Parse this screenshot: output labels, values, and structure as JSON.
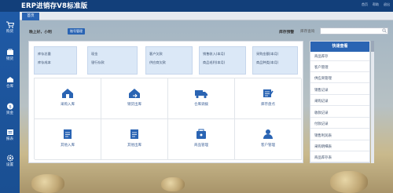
{
  "app": {
    "title": "ERP进销存V8标准版",
    "top_links": [
      "首页",
      "帮助",
      "退出"
    ]
  },
  "sidebar": {
    "items": [
      {
        "label": "购货",
        "icon": "cart-icon"
      },
      {
        "label": "销货",
        "icon": "sales-icon"
      },
      {
        "label": "仓库",
        "icon": "warehouse-icon"
      },
      {
        "label": "资金",
        "icon": "money-icon"
      },
      {
        "label": "报表",
        "icon": "report-icon"
      },
      {
        "label": "设置",
        "icon": "gear-icon"
      }
    ]
  },
  "tabs": [
    {
      "label": "首页"
    }
  ],
  "greeting": {
    "text": "晚上好，小明",
    "badge": "账号管理"
  },
  "stock": {
    "label": "库存预警",
    "query": "库存查询",
    "search_placeholder": ""
  },
  "stats": [
    {
      "a": "库存总量",
      "b": "库存成本"
    },
    {
      "a": "现金",
      "b": "银行存款"
    },
    {
      "a": "客户欠款",
      "b": "供应商欠款"
    },
    {
      "a": "销售收入(本月)",
      "b": "商品毛利(本月)"
    },
    {
      "a": "采购金额(本月)",
      "b": "商品种类(本月)"
    }
  ],
  "tiles": [
    {
      "label": "采购入库",
      "icon": "purchase-in-icon"
    },
    {
      "label": "销货出库",
      "icon": "sales-out-icon"
    },
    {
      "label": "仓库调拨",
      "icon": "truck-icon"
    },
    {
      "label": "库存盘点",
      "icon": "inventory-check-icon"
    },
    {
      "label": "其他入库",
      "icon": "other-in-icon"
    },
    {
      "label": "其他出库",
      "icon": "other-out-icon"
    },
    {
      "label": "商品管理",
      "icon": "goods-icon"
    },
    {
      "label": "客户管理",
      "icon": "customer-icon"
    }
  ],
  "quick": {
    "title": "快速查看",
    "items": [
      "商品库存",
      "客户管理",
      "供应商管理",
      "销售记录",
      "采购记录",
      "收款记录",
      "付款记录",
      "销售利润表",
      "采购明细表",
      "商品库存表"
    ]
  },
  "colors": {
    "primary": "#2a64b3",
    "topbar": "#123f7a",
    "sidebar": "#1f5aa6"
  }
}
